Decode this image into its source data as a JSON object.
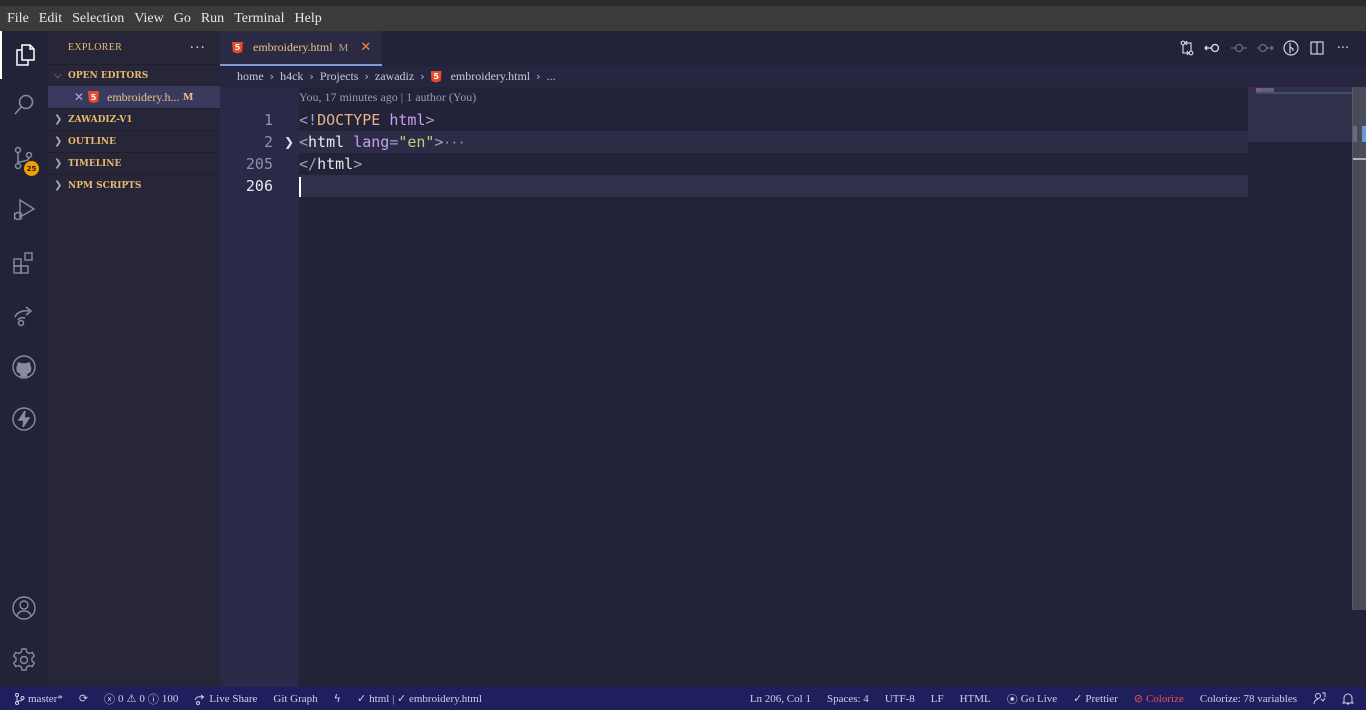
{
  "menu": [
    "File",
    "Edit",
    "Selection",
    "View",
    "Go",
    "Run",
    "Terminal",
    "Help"
  ],
  "activity_bar": {
    "items": [
      {
        "name": "explorer",
        "icon": "files-icon",
        "active": true
      },
      {
        "name": "search",
        "icon": "search-icon"
      },
      {
        "name": "source-control",
        "icon": "source-control-icon",
        "badge": "25"
      },
      {
        "name": "run-debug",
        "icon": "run-debug-icon"
      },
      {
        "name": "extensions",
        "icon": "extensions-icon"
      },
      {
        "name": "live-share",
        "icon": "live-share-icon"
      },
      {
        "name": "github",
        "icon": "github-icon"
      },
      {
        "name": "thunder",
        "icon": "lightning-icon"
      }
    ],
    "bottom": [
      {
        "name": "accounts",
        "icon": "account-icon"
      },
      {
        "name": "manage",
        "icon": "gear-icon"
      }
    ]
  },
  "sidebar": {
    "title": "EXPLORER",
    "more": "···",
    "open_editors": {
      "label": "OPEN EDITORS",
      "items": [
        {
          "name": "embroidery.h...",
          "status": "M",
          "close": "✕"
        }
      ]
    },
    "sections": [
      "ZAWADIZ-V1",
      "OUTLINE",
      "TIMELINE",
      "NPM SCRIPTS"
    ]
  },
  "tabs": [
    {
      "label": "embroidery.html",
      "status": "M",
      "close": "✕",
      "active": true
    }
  ],
  "breadcrumb": [
    "home",
    "h4ck",
    "Projects",
    "zawadiz",
    "embroidery.html",
    "..."
  ],
  "editor": {
    "codelens": "You, 17 minutes ago | 1 author (You)",
    "lines": [
      {
        "num": "1",
        "tokens": [
          {
            "t": "<!",
            "c": "punc"
          },
          {
            "t": "DOCTYPE",
            "c": "doc"
          },
          {
            "t": " ",
            "c": "punc"
          },
          {
            "t": "html",
            "c": "kw"
          },
          {
            "t": ">",
            "c": "punc"
          }
        ]
      },
      {
        "num": "2",
        "folded": true,
        "tokens": [
          {
            "t": "<",
            "c": "punc"
          },
          {
            "t": "html",
            "c": "tag"
          },
          {
            "t": " ",
            "c": "punc"
          },
          {
            "t": "lang",
            "c": "attr"
          },
          {
            "t": "=",
            "c": "punc"
          },
          {
            "t": "\"en\"",
            "c": "str"
          },
          {
            "t": ">",
            "c": "punc"
          },
          {
            "t": "···",
            "c": "ell"
          }
        ]
      },
      {
        "num": "205",
        "tokens": [
          {
            "t": "</",
            "c": "punc"
          },
          {
            "t": "html",
            "c": "tag"
          },
          {
            "t": ">",
            "c": "punc"
          }
        ]
      },
      {
        "num": "206",
        "current": true,
        "tokens": []
      }
    ]
  },
  "status_bar": {
    "branch": "master*",
    "errors": "0",
    "warnings": "0",
    "info": "100",
    "live_share": "Live Share",
    "git_graph": "Git Graph",
    "validation": "html | ✓ embroidery.html",
    "position": "Ln 206, Col 1",
    "spaces": "Spaces: 4",
    "encoding": "UTF-8",
    "eol": "LF",
    "language": "HTML",
    "go_live": "Go Live",
    "prettier": "Prettier",
    "colorize": "Colorize",
    "colorize_vars": "Colorize: 78 variables"
  }
}
